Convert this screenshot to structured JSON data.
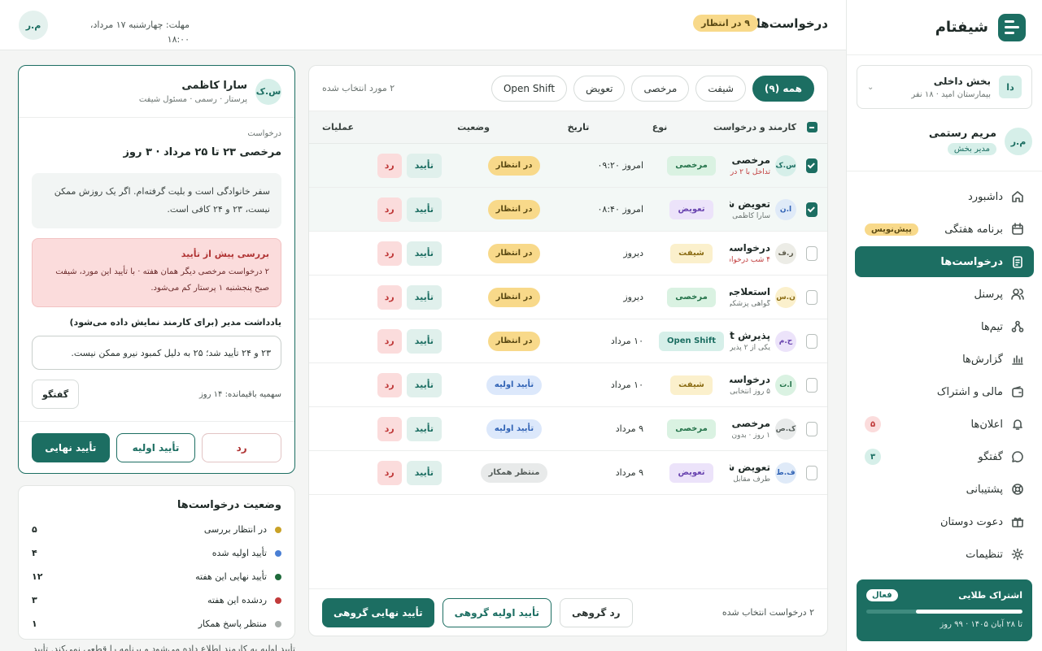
{
  "brand": {
    "name": "شیفتام"
  },
  "dept": {
    "avatar": "دا",
    "name": "بخش داخلی",
    "sub": "بیمارستان امید · ۱۸ نفر"
  },
  "user": {
    "avatar": "م.ر",
    "name": "مریم رستمی",
    "role": "مدیر بخش"
  },
  "nav": [
    {
      "label": "داشبورد",
      "icon": "home-icon"
    },
    {
      "label": "برنامه هفتگی",
      "icon": "calendar-icon",
      "badge": "پیش‌نویس"
    },
    {
      "label": "درخواست‌ها",
      "icon": "clipboard-icon",
      "active": true
    },
    {
      "label": "پرسنل",
      "icon": "users-icon"
    },
    {
      "label": "تیم‌ها",
      "icon": "teams-icon"
    },
    {
      "label": "گزارش‌ها",
      "icon": "chart-icon"
    },
    {
      "label": "مالی و اشتراک",
      "icon": "wallet-icon"
    },
    {
      "label": "اعلان‌ها",
      "icon": "bell-icon",
      "badge": "۵"
    },
    {
      "label": "گفتگو",
      "icon": "chat-icon",
      "badge": "۳"
    },
    {
      "label": "پشتیبانی",
      "icon": "support-icon"
    },
    {
      "label": "دعوت دوستان",
      "icon": "gift-icon"
    },
    {
      "label": "تنظیمات",
      "icon": "settings-icon"
    }
  ],
  "subscription": {
    "title": "اشتراک طلایی",
    "status": "فعال",
    "progress": 0.68,
    "expiry": "تا ۲۸ آبان ۱۴۰۵ · ۹۹ روز"
  },
  "topbar": {
    "title": "درخواست‌ها",
    "pending": "۹ در انتظار",
    "deadline": "مهلت: چهارشنبه ۱۷ مرداد، ۱۸:۰۰",
    "avatar": "م.ر"
  },
  "filters": {
    "tabs": [
      "همه (۹)",
      "شیفت",
      "مرخصی",
      "تعویض",
      "Open Shift"
    ],
    "selected_text": "۲ مورد انتخاب شده"
  },
  "table": {
    "headers": {
      "employee": "کارمند و درخواست",
      "type": "نوع",
      "date": "تاریخ",
      "status": "وضعیت",
      "ops": "عملیات"
    },
    "approve": "تأیید",
    "reject": "رد",
    "rows": [
      {
        "checked": true,
        "avatar": "س.ک",
        "avatar_bg": "#d6efe9",
        "avatar_fg": "#1c6e62",
        "title": "مرخصی ۲۳ تا ۲۵ مرداد",
        "sub": "تداخل با ۲ درخواست",
        "sub_red": true,
        "type": "مرخصی",
        "type_cls": "t-leave",
        "date": "امروز ۰۹:۲۰",
        "status": "در انتظار",
        "status_cls": "s-pend"
      },
      {
        "checked": true,
        "avatar": "ا.ن",
        "avatar_bg": "#dfeaf8",
        "avatar_fg": "#3163b5",
        "title": "تعویض شیفت",
        "sub": "سارا کاظمی",
        "type": "تعویض",
        "type_cls": "t-swap",
        "date": "امروز ۰۸:۴۰",
        "status": "در انتظار",
        "status_cls": "s-pend"
      },
      {
        "checked": false,
        "avatar": "ر.ف",
        "avatar_bg": "#ecece6",
        "avatar_fg": "#5c5a4a",
        "title": "درخواست شیفت",
        "sub": "۴ شب درخواستی",
        "sub_red": true,
        "type": "شیفت",
        "type_cls": "t-shift",
        "date": "دیروز",
        "status": "در انتظار",
        "status_cls": "s-pend"
      },
      {
        "checked": false,
        "avatar": "ن.س",
        "avatar_bg": "#fbf0cc",
        "avatar_fg": "#8a6b12",
        "title": "استعلاجی",
        "sub": "گواهی پزشکی",
        "type": "مرخصی",
        "type_cls": "t-leave",
        "date": "دیروز",
        "status": "در انتظار",
        "status_cls": "s-pend"
      },
      {
        "checked": false,
        "avatar": "ح.م",
        "avatar_bg": "#ece3fa",
        "avatar_fg": "#6a45b0",
        "title": "پذیرش Open Shift",
        "sub": "یکی از ۲ پذیرش",
        "type": "Open Shift",
        "type_cls": "t-open",
        "date": "۱۰ مرداد",
        "status": "در انتظار",
        "status_cls": "s-pend"
      },
      {
        "checked": false,
        "avatar": "ا.ت",
        "avatar_bg": "#daf2e2",
        "avatar_fg": "#24734a",
        "title": "درخواست شیفت",
        "sub": "۵ روز انتخابی",
        "type": "شیفت",
        "type_cls": "t-shift",
        "date": "۱۰ مرداد",
        "status": "تأیید اولیه",
        "status_cls": "s-init"
      },
      {
        "checked": false,
        "avatar": "ک.ص",
        "avatar_bg": "#e8eaea",
        "avatar_fg": "#555d5a",
        "title": "مرخصی ساعتی",
        "sub": "۱ روز · بدون حقوق",
        "type": "مرخصی",
        "type_cls": "t-leave",
        "date": "۹ مرداد",
        "status": "تأیید اولیه",
        "status_cls": "s-init"
      },
      {
        "checked": false,
        "avatar": "ف.ط",
        "avatar_bg": "#dfeaf8",
        "avatar_fg": "#3163b5",
        "title": "تعویض شیفت",
        "sub": "طرف مقابل",
        "type": "تعویض",
        "type_cls": "t-swap",
        "date": "۹ مرداد",
        "status": "منتظر همکار",
        "status_cls": "s-wait"
      }
    ]
  },
  "list_footer": {
    "count": "۲ درخواست انتخاب شده",
    "reject": "رد گروهی",
    "initial": "تأیید اولیه گروهی",
    "final": "تأیید نهایی گروهی"
  },
  "detail": {
    "avatar": "س.ک",
    "name": "سارا کاظمی",
    "role": "پرستار · رسمی · مسئول شیفت",
    "label": "درخواست",
    "title": "مرخصی ۲۳ تا ۲۵ مرداد · ۳ روز",
    "note": "سفر خانوادگی است و بلیت گرفته‌ام. اگر یک روزش ممکن نیست، ۲۳ و ۲۴ کافی است.",
    "warn_title": "بررسی پیش از تأیید",
    "warn_text": "۲ درخواست مرخصی دیگر همان هفته · با تأیید این مورد، شیفت صبح پنجشنبه ۱ پرستار کم می‌شود.",
    "mgr_label": "یادداشت مدیر (برای کارمند نمایش داده می‌شود)",
    "mgr_value": "۲۳ و ۲۴ تأیید شد؛ ۲۵ به دلیل کمبود نیرو ممکن نیست.",
    "remaining": "سهمیه باقیمانده: ۱۴ روز",
    "chat": "گفتگو",
    "final": "تأیید نهایی",
    "initial": "تأیید اولیه",
    "reject": "رد"
  },
  "stats": {
    "title": "وضعیت درخواست‌ها",
    "items": [
      {
        "label": "در انتظار بررسی",
        "value": "۵",
        "color": "#c9a227"
      },
      {
        "label": "تأیید اولیه شده",
        "value": "۴",
        "color": "#4a7fd4"
      },
      {
        "label": "تأیید نهایی این هفته",
        "value": "۱۲",
        "color": "#1f6b3b"
      },
      {
        "label": "ردشده این هفته",
        "value": "۳",
        "color": "#c23b3b"
      },
      {
        "label": "منتظر پاسخ همکار",
        "value": "۱",
        "color": "#a8aeab"
      }
    ]
  },
  "bottom_note": "تأیید اولیه به کارمند اطلاع داده می‌شود و برنامه را قطعی نمی‌کند. تأیید"
}
